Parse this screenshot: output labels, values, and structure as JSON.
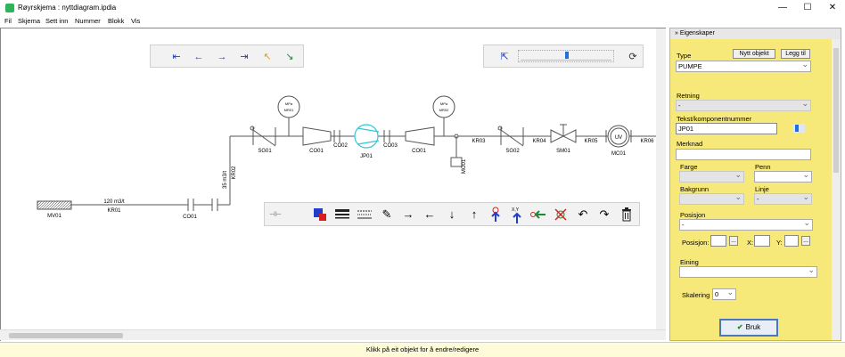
{
  "window": {
    "title": "Røyrskjema : nyttdiagram.ipdia",
    "minimize": "—",
    "maximize": "☐",
    "close": "✕"
  },
  "menu": [
    "Fil",
    "Skjema",
    "Sett inn",
    "Nummer",
    "Blokk",
    "Vis"
  ],
  "diagram": {
    "labels": {
      "mv01": "MV01",
      "kr01_flow": "120 m3/t",
      "kr01": "KR01",
      "co01_left": "CO01",
      "kr02_flow": "35 m3/t",
      "kr02": "KR02",
      "sg01": "SG01",
      "co01_a": "CO01",
      "co02": "CO02",
      "jp01": "JP01",
      "co03": "CO03",
      "co01_b": "CO01",
      "kr03": "KR03",
      "sg02": "SG02",
      "kr04": "KR04",
      "sm01": "SM01",
      "kr05": "KR05",
      "mc01": "MC01",
      "kr06": "KR06",
      "mo01": "MO01",
      "gauge1_a": "MPa",
      "gauge1_b": "MR01",
      "gauge2_a": "MPa",
      "gauge2_b": "MR02",
      "uv": "UV",
      "xy": "X,Y"
    }
  },
  "statusbar": {
    "text": "Klikk på eit objekt for å endre/redigere"
  },
  "panel": {
    "title": "Eigenskaper",
    "new_object": "Nytt objekt",
    "add": "Legg til",
    "type_label": "Type",
    "type_value": "PUMPE",
    "direction_label": "Retning",
    "direction_value": "-",
    "text_label": "Tekst/komponentnummer",
    "text_value": "JP01",
    "remark_label": "Merknad",
    "remark_value": "",
    "color_label": "Farge",
    "pen_label": "Penn",
    "background_label": "Bakgrunn",
    "line_label": "Linje",
    "line_value": "-",
    "position_label": "Posisjon",
    "position_value": "-",
    "position_field_label": "Posisjon:",
    "x_label": "X:",
    "y_label": "Y:",
    "ellipsis": "...",
    "unit_label": "Eining",
    "scale_label": "Skalering",
    "scale_value": "0",
    "ok_label": "Bruk"
  }
}
